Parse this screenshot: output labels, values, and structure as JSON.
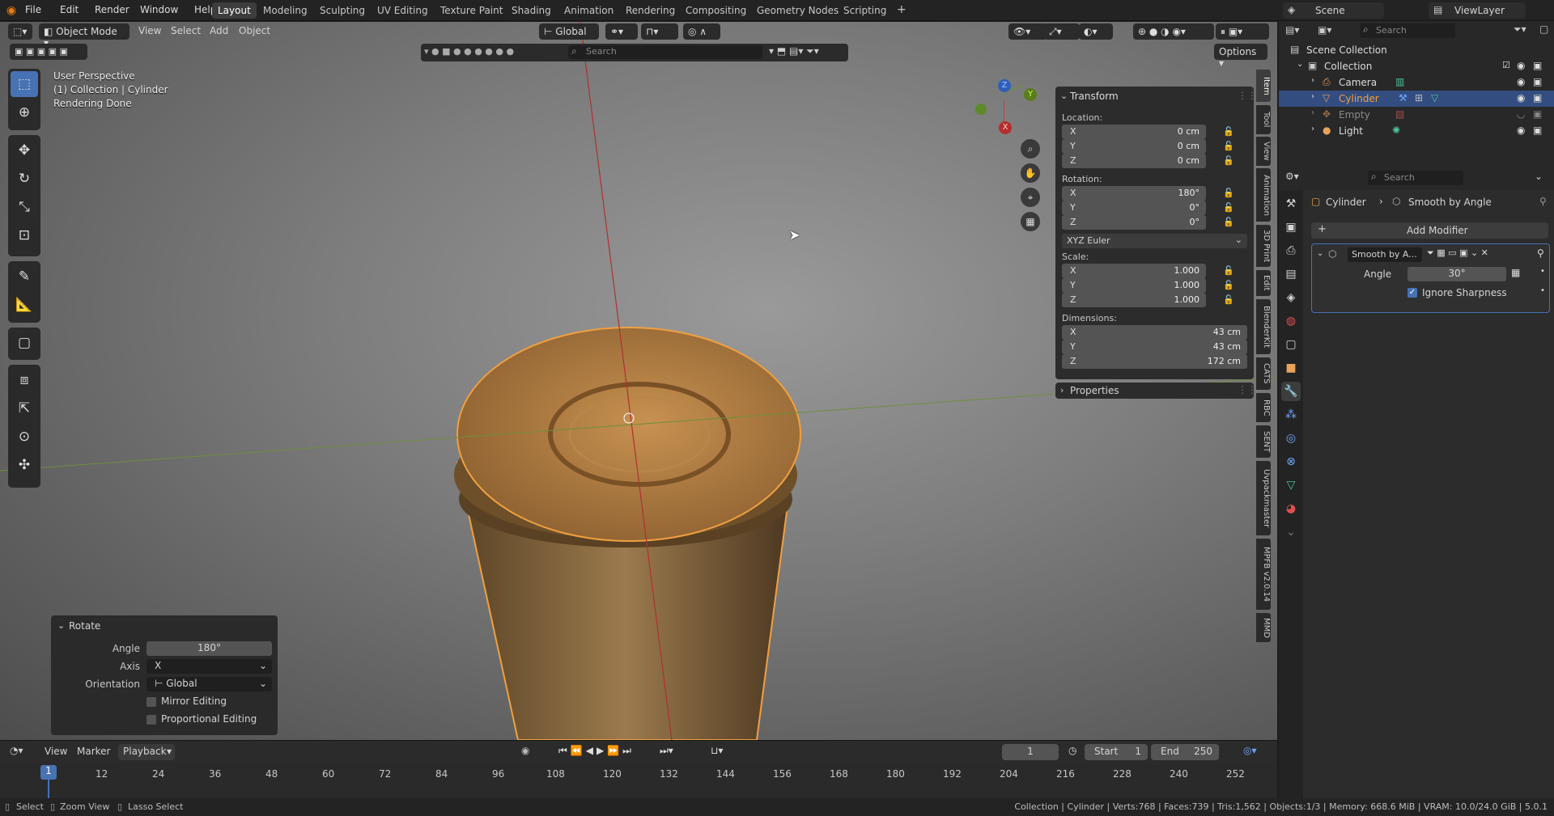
{
  "topbar": {
    "menus": [
      "File",
      "Edit",
      "Render",
      "Window",
      "Help"
    ],
    "workspaces": [
      "Layout",
      "Modeling",
      "Sculpting",
      "UV Editing",
      "Texture Paint",
      "Shading",
      "Animation",
      "Rendering",
      "Compositing",
      "Geometry Nodes",
      "Scripting"
    ],
    "add_tab": "+",
    "scene": "Scene",
    "viewlayer": "ViewLayer"
  },
  "viewport_header": {
    "mode": "Object Mode",
    "menus": [
      "View",
      "Select",
      "Add",
      "Object"
    ],
    "orientation": "Global",
    "search_placeholder": "Search",
    "options": "Options"
  },
  "overlay": {
    "line1": "User Perspective",
    "line2": "(1) Collection | Cylinder",
    "line3": "Rendering Done"
  },
  "gizmo": {
    "z": "Z",
    "y": "Y",
    "x": "X"
  },
  "npanel": {
    "title": "Transform",
    "location_label": "Location:",
    "location": [
      {
        "axis": "X",
        "value": "0 cm"
      },
      {
        "axis": "Y",
        "value": "0 cm"
      },
      {
        "axis": "Z",
        "value": "0 cm"
      }
    ],
    "rotation_label": "Rotation:",
    "rotation": [
      {
        "axis": "X",
        "value": "180°"
      },
      {
        "axis": "Y",
        "value": "0°"
      },
      {
        "axis": "Z",
        "value": "0°"
      }
    ],
    "rotation_mode": "XYZ Euler",
    "scale_label": "Scale:",
    "scale": [
      {
        "axis": "X",
        "value": "1.000"
      },
      {
        "axis": "Y",
        "value": "1.000"
      },
      {
        "axis": "Z",
        "value": "1.000"
      }
    ],
    "dimensions_label": "Dimensions:",
    "dimensions": [
      {
        "axis": "X",
        "value": "43 cm"
      },
      {
        "axis": "Y",
        "value": "43 cm"
      },
      {
        "axis": "Z",
        "value": "172 cm"
      }
    ],
    "properties": "Properties"
  },
  "side_tabs": [
    "Item",
    "Tool",
    "View",
    "Animation",
    "3D Print",
    "Edit",
    "BlenderKit",
    "CATS",
    "RBC",
    "SENT",
    "Uvpackmaster",
    "MPFB v2.0.14",
    "MMD"
  ],
  "redo": {
    "title": "Rotate",
    "angle_label": "Angle",
    "angle": "180°",
    "axis_label": "Axis",
    "axis": "X",
    "orientation_label": "Orientation",
    "orientation": "Global",
    "mirror": "Mirror Editing",
    "proportional": "Proportional Editing"
  },
  "timeline": {
    "menus": [
      "View",
      "Marker",
      "Playback"
    ],
    "current_frame": "1",
    "start_label": "Start",
    "start": "1",
    "end_label": "End",
    "end": "250",
    "ticks": [
      "1",
      "12",
      "24",
      "36",
      "48",
      "60",
      "72",
      "84",
      "96",
      "108",
      "120",
      "132",
      "144",
      "156",
      "168",
      "180",
      "192",
      "204",
      "216",
      "228",
      "240",
      "252"
    ]
  },
  "statusbar": {
    "select": "Select",
    "zoom": "Zoom View",
    "lasso": "Lasso Select",
    "info": "Collection | Cylinder | Verts:768 | Faces:739 | Tris:1,562 | Objects:1/3 | Memory: 668.6 MiB | VRAM: 10.0/24.0 GiB | 5.0.1"
  },
  "outliner": {
    "search_placeholder": "Search",
    "root": "Scene Collection",
    "collection": "Collection",
    "items": [
      "Camera",
      "Cylinder",
      "Empty",
      "Light"
    ]
  },
  "properties": {
    "search_placeholder": "Search",
    "breadcrumb_object": "Cylinder",
    "breadcrumb_modifier": "Smooth by Angle",
    "add_modifier": "Add Modifier",
    "modifier_name": "Smooth by A...",
    "angle_label": "Angle",
    "angle": "30°",
    "ignore_sharpness": "Ignore Sharpness"
  },
  "colors": {
    "accent": "#4772b3",
    "selected_object": "#f0a040",
    "object_text": "#e6a05a"
  }
}
